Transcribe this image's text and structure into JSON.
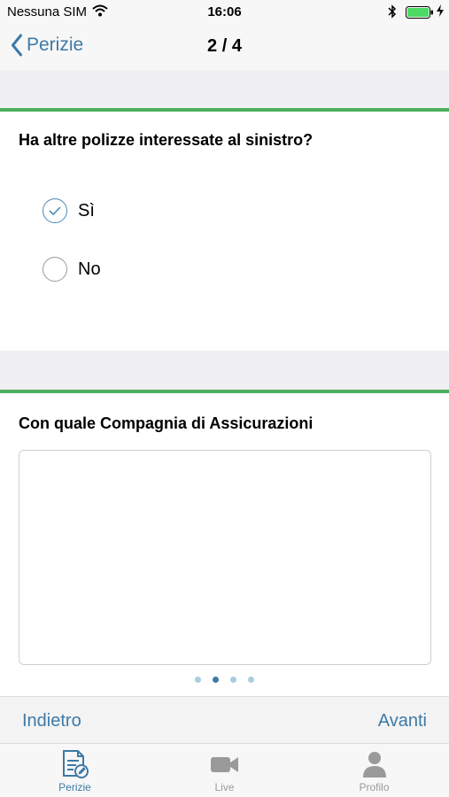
{
  "status_bar": {
    "carrier": "Nessuna SIM",
    "time": "16:06",
    "icons": [
      "wifi-icon",
      "bluetooth-icon",
      "battery-icon",
      "charging-icon"
    ]
  },
  "nav": {
    "back_label": "Perizie",
    "title": "2 / 4",
    "back_icon": "chevron-left-icon"
  },
  "questions": [
    {
      "text": "Ha altre polizze interessate al sinistro?",
      "options": [
        {
          "label": "Sì",
          "selected": true
        },
        {
          "label": "No",
          "selected": false
        }
      ]
    },
    {
      "text": "Con quale Compagnia di Assicurazioni",
      "input_value": ""
    }
  ],
  "pagination": {
    "pages": 4,
    "current": 2
  },
  "actions": {
    "prev_label": "Indietro",
    "next_label": "Avanti"
  },
  "tabs": [
    {
      "label": "Perizie",
      "icon": "document-edit-icon",
      "active": true
    },
    {
      "label": "Live",
      "icon": "video-camera-icon",
      "active": false
    },
    {
      "label": "Profilo",
      "icon": "person-icon",
      "active": false
    }
  ],
  "colors": {
    "accent": "#3d7aa6",
    "divider_green": "#4cae5e",
    "band_gray": "#efeff4",
    "battery_green": "#4cd964"
  }
}
